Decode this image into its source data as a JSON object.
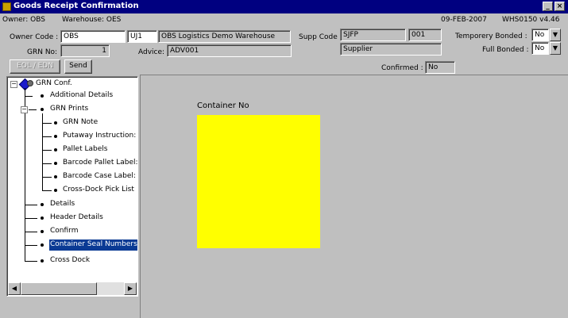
{
  "window": {
    "title": "Goods Receipt Confirmation",
    "minimize": "_",
    "close": "×"
  },
  "info": {
    "owner": "Owner: OBS",
    "warehouse": "Warehouse: OES",
    "date": "09-FEB-2007",
    "version": "WHS0150  v4.46"
  },
  "form": {
    "owner_code_label": "Owner Code :",
    "owner_code": "OBS",
    "warehouse_code": "UJ1",
    "warehouse_name": "OBS Logistics Demo Warehouse",
    "supp_code_label": "Supp Code :",
    "supp_code": "SJFP",
    "supp_code_2": "001",
    "supplier": "Supplier",
    "temp_bonded_label": "Temporery Bonded :",
    "temp_bonded": "No",
    "full_bonded_label": "Full Bonded :",
    "full_bonded": "No",
    "grn_no_label": "GRN No:",
    "grn_no": "1",
    "advice_label": "Advice:",
    "advice": "ADV001",
    "confirmed_label": "Confirmed :",
    "confirmed": "No"
  },
  "buttons": {
    "eol": "EOL / EDN",
    "send": "Send"
  },
  "tree": {
    "root": "GRN Conf.",
    "items": [
      "Additional Details",
      "GRN Prints",
      "GRN Note",
      "Putaway Instruction:",
      "Pallet Labels",
      "Barcode Pallet Label:",
      "Barcode Case Label:",
      "Cross-Dock Pick List",
      "Details",
      "Header Details",
      "Confirm",
      "Container Seal Numbers",
      "Cross Dock"
    ]
  },
  "content": {
    "container_label": "Container No",
    "box_color": "#ffff00"
  }
}
